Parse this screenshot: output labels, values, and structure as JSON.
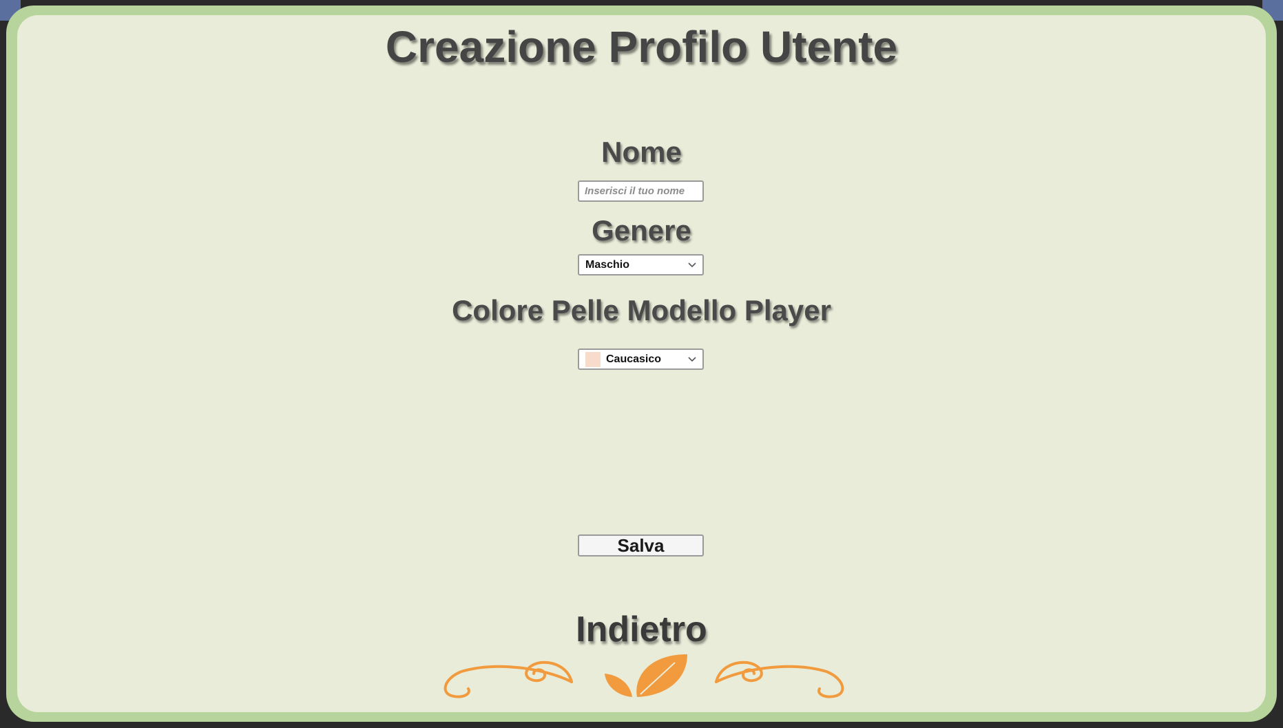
{
  "page": {
    "title": "Creazione Profilo Utente"
  },
  "form": {
    "name": {
      "label": "Nome",
      "placeholder": "Inserisci il tuo nome",
      "value": ""
    },
    "gender": {
      "label": "Genere",
      "selected": "Maschio"
    },
    "skin_color": {
      "label": "Colore Pelle Modello Player",
      "selected": "Caucasico",
      "swatch_color": "#f7dccb"
    }
  },
  "actions": {
    "save_label": "Salva",
    "back_label": "Indietro"
  },
  "colors": {
    "frame": "#b6d49c",
    "panel": "#e8ecd8",
    "ornament": "#f19a3e"
  },
  "icons": {
    "dropdown": "chevron-down-icon",
    "decoration": "leaf-swirl-ornament"
  }
}
